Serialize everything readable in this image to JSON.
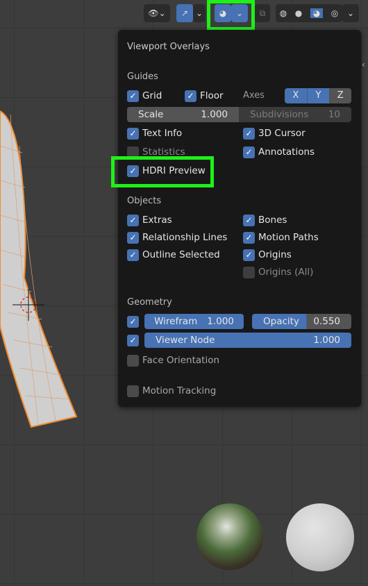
{
  "header": {
    "visibility_icon": "selectability-visibility-icon",
    "gizmo_icon": "gizmo-icon",
    "overlay_icon": "overlays-icon",
    "xray_icon": "xray-icon",
    "shading_modes": [
      "wireframe-shading-icon",
      "solid-shading-icon",
      "material-preview-icon",
      "rendered-shading-icon"
    ]
  },
  "popup": {
    "title": "Viewport Overlays",
    "guides": {
      "heading": "Guides",
      "grid": {
        "label": "Grid",
        "checked": true
      },
      "floor": {
        "label": "Floor",
        "checked": true
      },
      "axes_label": "Axes",
      "axes": [
        {
          "label": "X",
          "active": true
        },
        {
          "label": "Y",
          "active": true
        },
        {
          "label": "Z",
          "active": false
        }
      ],
      "scale": {
        "label": "Scale",
        "value": "1.000"
      },
      "subdivisions": {
        "label": "Subdivisions",
        "value": "10"
      },
      "text_info": {
        "label": "Text Info",
        "checked": true
      },
      "cursor": {
        "label": "3D Cursor",
        "checked": true
      },
      "statistics": {
        "label": "Statistics",
        "checked": false
      },
      "annotations": {
        "label": "Annotations",
        "checked": true
      },
      "hdri": {
        "label": "HDRI Preview",
        "checked": true
      }
    },
    "objects": {
      "heading": "Objects",
      "extras": {
        "label": "Extras",
        "checked": true
      },
      "bones": {
        "label": "Bones",
        "checked": true
      },
      "relationship": {
        "label": "Relationship Lines",
        "checked": true
      },
      "motion_paths": {
        "label": "Motion Paths",
        "checked": true
      },
      "outline": {
        "label": "Outline Selected",
        "checked": true
      },
      "origins": {
        "label": "Origins",
        "checked": true
      },
      "origins_all": {
        "label": "Origins (All)",
        "checked": false
      }
    },
    "geometry": {
      "heading": "Geometry",
      "wireframe": {
        "label": "Wirefram",
        "value": "1.000",
        "checked": true
      },
      "opacity": {
        "label": "Opacity",
        "value": "0.550",
        "fraction": 0.55
      },
      "viewer_node": {
        "label": "Viewer Node",
        "value": "1.000",
        "checked": true
      },
      "face_orientation": {
        "label": "Face Orientation",
        "checked": false
      }
    },
    "motion_tracking": {
      "label": "Motion Tracking",
      "checked": false
    }
  },
  "colors": {
    "accent": "#4772b3",
    "highlight": "#1ff018",
    "mesh_edge": "#f08a2a"
  }
}
